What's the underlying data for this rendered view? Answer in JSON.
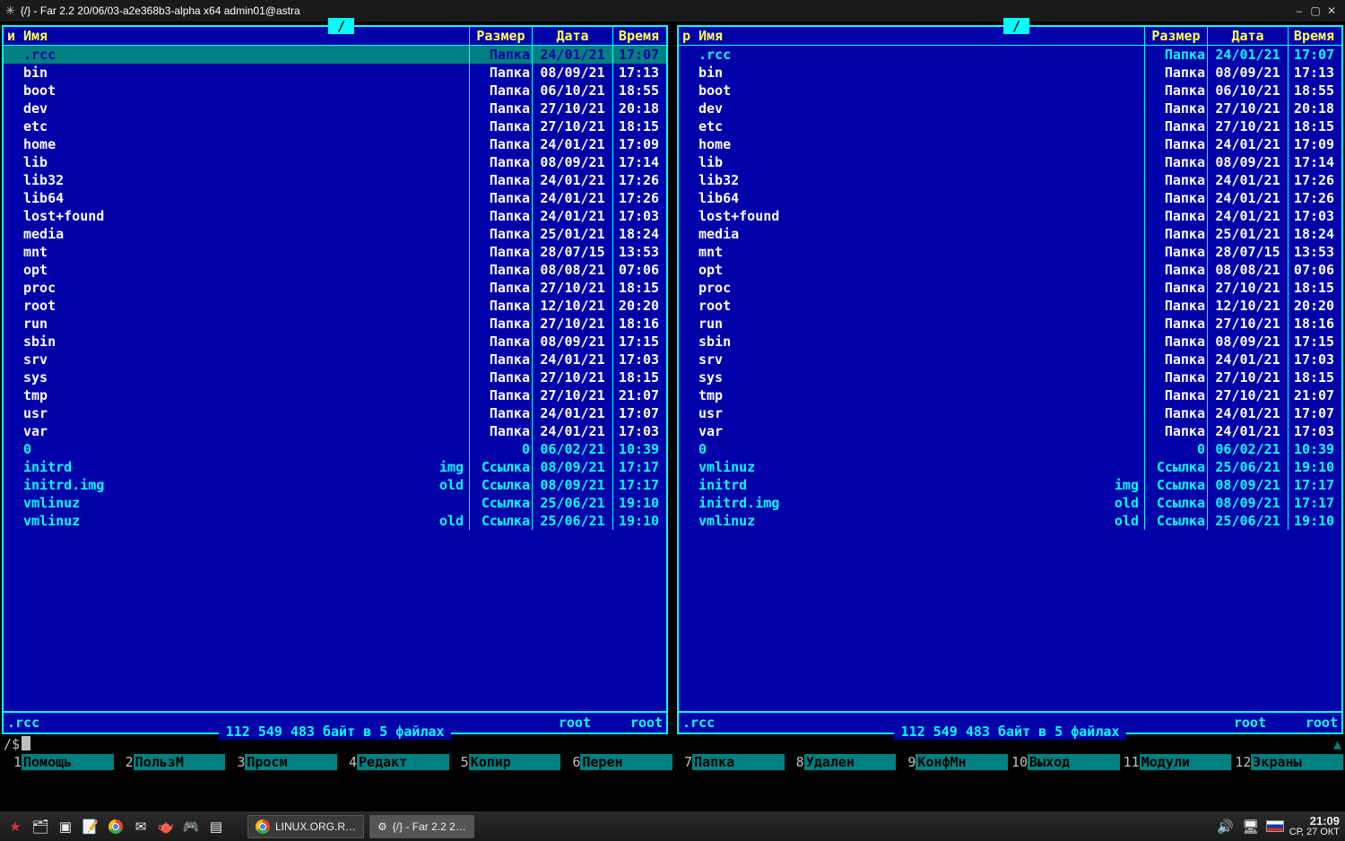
{
  "window": {
    "title": "{/} - Far 2.2 20/06/03-a2e368b3-alpha x64 admin01@astra"
  },
  "headers": {
    "sort_left": "и",
    "sort_right": "p",
    "name": "Имя",
    "size": "Размер",
    "date": "Дата",
    "time": "Время"
  },
  "panel_title": "/",
  "left": {
    "files": [
      {
        "name": ".rcc",
        "ext": "",
        "size": "Папка",
        "date": "24/01/21",
        "time": "17:07",
        "type": "folder",
        "selected": true
      },
      {
        "name": "bin",
        "ext": "",
        "size": "Папка",
        "date": "08/09/21",
        "time": "17:13",
        "type": "folder"
      },
      {
        "name": "boot",
        "ext": "",
        "size": "Папка",
        "date": "06/10/21",
        "time": "18:55",
        "type": "folder"
      },
      {
        "name": "dev",
        "ext": "",
        "size": "Папка",
        "date": "27/10/21",
        "time": "20:18",
        "type": "folder"
      },
      {
        "name": "etc",
        "ext": "",
        "size": "Папка",
        "date": "27/10/21",
        "time": "18:15",
        "type": "folder"
      },
      {
        "name": "home",
        "ext": "",
        "size": "Папка",
        "date": "24/01/21",
        "time": "17:09",
        "type": "folder"
      },
      {
        "name": "lib",
        "ext": "",
        "size": "Папка",
        "date": "08/09/21",
        "time": "17:14",
        "type": "folder"
      },
      {
        "name": "lib32",
        "ext": "",
        "size": "Папка",
        "date": "24/01/21",
        "time": "17:26",
        "type": "folder"
      },
      {
        "name": "lib64",
        "ext": "",
        "size": "Папка",
        "date": "24/01/21",
        "time": "17:26",
        "type": "folder"
      },
      {
        "name": "lost+found",
        "ext": "",
        "size": "Папка",
        "date": "24/01/21",
        "time": "17:03",
        "type": "folder"
      },
      {
        "name": "media",
        "ext": "",
        "size": "Папка",
        "date": "25/01/21",
        "time": "18:24",
        "type": "folder"
      },
      {
        "name": "mnt",
        "ext": "",
        "size": "Папка",
        "date": "28/07/15",
        "time": "13:53",
        "type": "folder"
      },
      {
        "name": "opt",
        "ext": "",
        "size": "Папка",
        "date": "08/08/21",
        "time": "07:06",
        "type": "folder"
      },
      {
        "name": "proc",
        "ext": "",
        "size": "Папка",
        "date": "27/10/21",
        "time": "18:15",
        "type": "folder"
      },
      {
        "name": "root",
        "ext": "",
        "size": "Папка",
        "date": "12/10/21",
        "time": "20:20",
        "type": "folder"
      },
      {
        "name": "run",
        "ext": "",
        "size": "Папка",
        "date": "27/10/21",
        "time": "18:16",
        "type": "folder"
      },
      {
        "name": "sbin",
        "ext": "",
        "size": "Папка",
        "date": "08/09/21",
        "time": "17:15",
        "type": "folder"
      },
      {
        "name": "srv",
        "ext": "",
        "size": "Папка",
        "date": "24/01/21",
        "time": "17:03",
        "type": "folder"
      },
      {
        "name": "sys",
        "ext": "",
        "size": "Папка",
        "date": "27/10/21",
        "time": "18:15",
        "type": "folder"
      },
      {
        "name": "tmp",
        "ext": "",
        "size": "Папка",
        "date": "27/10/21",
        "time": "21:07",
        "type": "folder"
      },
      {
        "name": "usr",
        "ext": "",
        "size": "Папка",
        "date": "24/01/21",
        "time": "17:07",
        "type": "folder"
      },
      {
        "name": "var",
        "ext": "",
        "size": "Папка",
        "date": "24/01/21",
        "time": "17:03",
        "type": "folder"
      },
      {
        "name": "0",
        "ext": "",
        "size": "0",
        "date": "06/02/21",
        "time": "10:39",
        "type": "zero"
      },
      {
        "name": "initrd",
        "ext": "img",
        "size": "Ссылка",
        "date": "08/09/21",
        "time": "17:17",
        "type": "link"
      },
      {
        "name": "initrd.img",
        "ext": "old",
        "size": "Ссылка",
        "date": "08/09/21",
        "time": "17:17",
        "type": "link"
      },
      {
        "name": "vmlinuz",
        "ext": "",
        "size": "Ссылка",
        "date": "25/06/21",
        "time": "19:10",
        "type": "link"
      },
      {
        "name": "vmlinuz",
        "ext": "old",
        "size": "Ссылка",
        "date": "25/06/21",
        "time": "19:10",
        "type": "link"
      }
    ],
    "footer": {
      "name": ".rcc",
      "owner": "root",
      "group": "root"
    },
    "status": "112 549 483 байт в 5 файлах"
  },
  "right": {
    "files": [
      {
        "name": ".rcc",
        "ext": "",
        "size": "Папка",
        "date": "24/01/21",
        "time": "17:07",
        "type": "link"
      },
      {
        "name": "bin",
        "ext": "",
        "size": "Папка",
        "date": "08/09/21",
        "time": "17:13",
        "type": "folder"
      },
      {
        "name": "boot",
        "ext": "",
        "size": "Папка",
        "date": "06/10/21",
        "time": "18:55",
        "type": "folder"
      },
      {
        "name": "dev",
        "ext": "",
        "size": "Папка",
        "date": "27/10/21",
        "time": "20:18",
        "type": "folder"
      },
      {
        "name": "etc",
        "ext": "",
        "size": "Папка",
        "date": "27/10/21",
        "time": "18:15",
        "type": "folder"
      },
      {
        "name": "home",
        "ext": "",
        "size": "Папка",
        "date": "24/01/21",
        "time": "17:09",
        "type": "folder"
      },
      {
        "name": "lib",
        "ext": "",
        "size": "Папка",
        "date": "08/09/21",
        "time": "17:14",
        "type": "folder"
      },
      {
        "name": "lib32",
        "ext": "",
        "size": "Папка",
        "date": "24/01/21",
        "time": "17:26",
        "type": "folder"
      },
      {
        "name": "lib64",
        "ext": "",
        "size": "Папка",
        "date": "24/01/21",
        "time": "17:26",
        "type": "folder"
      },
      {
        "name": "lost+found",
        "ext": "",
        "size": "Папка",
        "date": "24/01/21",
        "time": "17:03",
        "type": "folder"
      },
      {
        "name": "media",
        "ext": "",
        "size": "Папка",
        "date": "25/01/21",
        "time": "18:24",
        "type": "folder"
      },
      {
        "name": "mnt",
        "ext": "",
        "size": "Папка",
        "date": "28/07/15",
        "time": "13:53",
        "type": "folder"
      },
      {
        "name": "opt",
        "ext": "",
        "size": "Папка",
        "date": "08/08/21",
        "time": "07:06",
        "type": "folder"
      },
      {
        "name": "proc",
        "ext": "",
        "size": "Папка",
        "date": "27/10/21",
        "time": "18:15",
        "type": "folder"
      },
      {
        "name": "root",
        "ext": "",
        "size": "Папка",
        "date": "12/10/21",
        "time": "20:20",
        "type": "folder"
      },
      {
        "name": "run",
        "ext": "",
        "size": "Папка",
        "date": "27/10/21",
        "time": "18:16",
        "type": "folder"
      },
      {
        "name": "sbin",
        "ext": "",
        "size": "Папка",
        "date": "08/09/21",
        "time": "17:15",
        "type": "folder"
      },
      {
        "name": "srv",
        "ext": "",
        "size": "Папка",
        "date": "24/01/21",
        "time": "17:03",
        "type": "folder"
      },
      {
        "name": "sys",
        "ext": "",
        "size": "Папка",
        "date": "27/10/21",
        "time": "18:15",
        "type": "folder"
      },
      {
        "name": "tmp",
        "ext": "",
        "size": "Папка",
        "date": "27/10/21",
        "time": "21:07",
        "type": "folder"
      },
      {
        "name": "usr",
        "ext": "",
        "size": "Папка",
        "date": "24/01/21",
        "time": "17:07",
        "type": "folder"
      },
      {
        "name": "var",
        "ext": "",
        "size": "Папка",
        "date": "24/01/21",
        "time": "17:03",
        "type": "folder"
      },
      {
        "name": "0",
        "ext": "",
        "size": "0",
        "date": "06/02/21",
        "time": "10:39",
        "type": "zero"
      },
      {
        "name": "vmlinuz",
        "ext": "",
        "size": "Ссылка",
        "date": "25/06/21",
        "time": "19:10",
        "type": "link"
      },
      {
        "name": "initrd",
        "ext": "img",
        "size": "Ссылка",
        "date": "08/09/21",
        "time": "17:17",
        "type": "link"
      },
      {
        "name": "initrd.img",
        "ext": "old",
        "size": "Ссылка",
        "date": "08/09/21",
        "time": "17:17",
        "type": "link"
      },
      {
        "name": "vmlinuz",
        "ext": "old",
        "size": "Ссылка",
        "date": "25/06/21",
        "time": "19:10",
        "type": "link"
      }
    ],
    "footer": {
      "name": ".rcc",
      "owner": "root",
      "group": "root"
    },
    "status": "112 549 483 байт в 5 файлах"
  },
  "cmdline": {
    "prompt": "/$"
  },
  "keybar": [
    {
      "n": "1",
      "l": "Помощь"
    },
    {
      "n": "2",
      "l": "ПользМ"
    },
    {
      "n": "3",
      "l": "Просм"
    },
    {
      "n": "4",
      "l": "Редакт"
    },
    {
      "n": "5",
      "l": "Копир"
    },
    {
      "n": "6",
      "l": "Перен"
    },
    {
      "n": "7",
      "l": "Папка"
    },
    {
      "n": "8",
      "l": "Удален"
    },
    {
      "n": "9",
      "l": "КонфМн"
    },
    {
      "n": "10",
      "l": "Выход"
    },
    {
      "n": "11",
      "l": "Модули"
    },
    {
      "n": "12",
      "l": "Экраны"
    }
  ],
  "taskbar": {
    "btn1": "LINUX.ORG.R…",
    "btn2": "{/} - Far 2.2 2…",
    "time": "21:09",
    "date": "СР, 27 ОКТ"
  }
}
